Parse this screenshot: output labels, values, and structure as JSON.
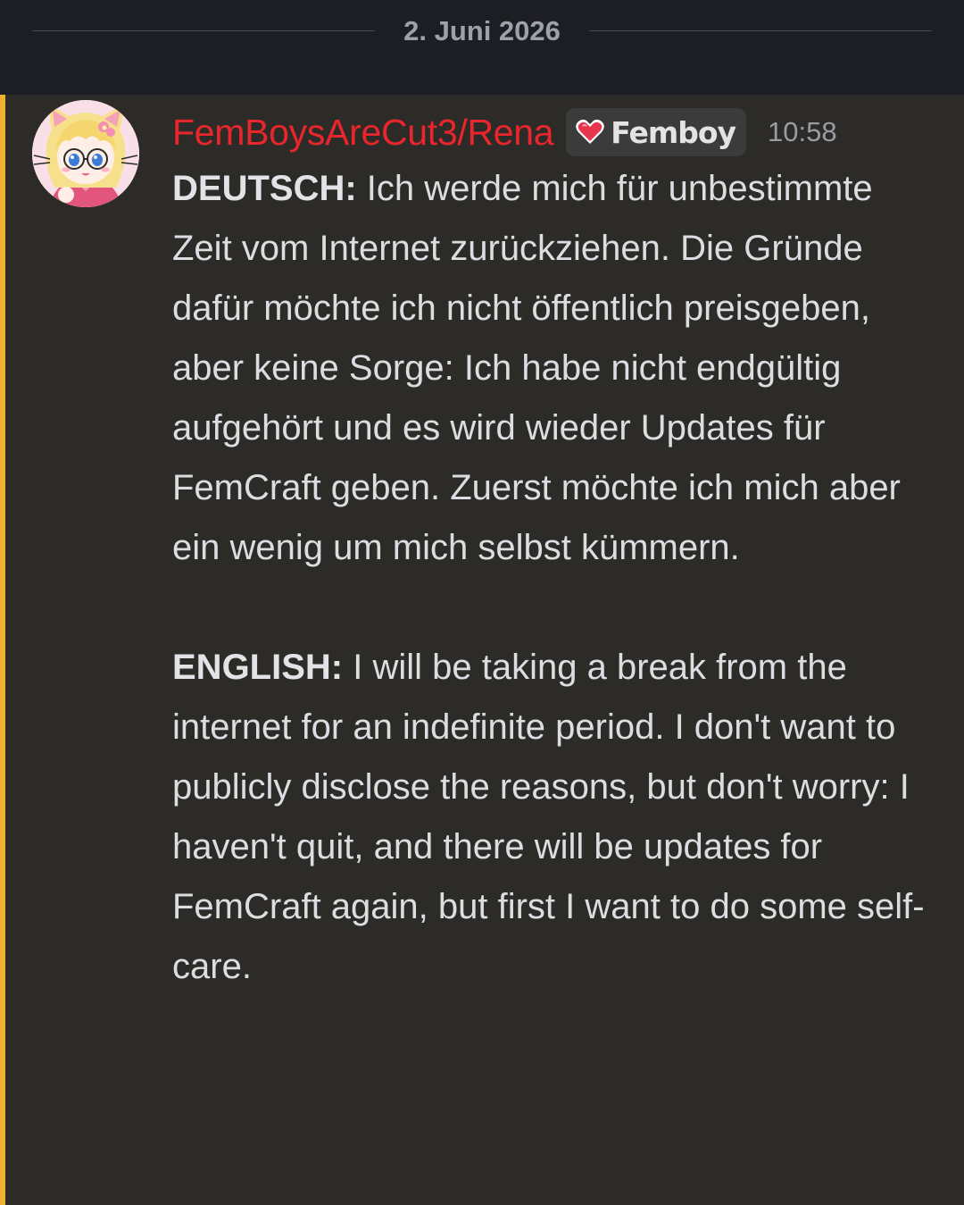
{
  "divider": {
    "date": "2. Juni 2026"
  },
  "message": {
    "author": {
      "name": "FemBoysAreCut3/Rena",
      "name_color": "#e8262b",
      "role_icon": "heart-icon",
      "role_label": "Femboy"
    },
    "timestamp": "10:58",
    "highlight_color": "#f0b132",
    "german": {
      "prefix": "DEUTSCH:",
      "text": " Ich werde mich für unbestimmte Zeit vom Internet zurückziehen. Die Gründe dafür möchte ich nicht öffentlich preisgeben, aber keine Sorge: Ich habe nicht endgültig aufgehört und es wird wieder Updates für FemCraft geben. Zuerst möchte ich mich aber ein wenig um mich selbst kümmern."
    },
    "english": {
      "prefix": "ENGLISH:",
      "text": " I will be taking a break from the internet for an indefinite period. I don't want to publicly disclose the reasons, but don't worry: I haven't quit, and there will be updates for FemCraft again, but first I want to do some self-care."
    }
  }
}
